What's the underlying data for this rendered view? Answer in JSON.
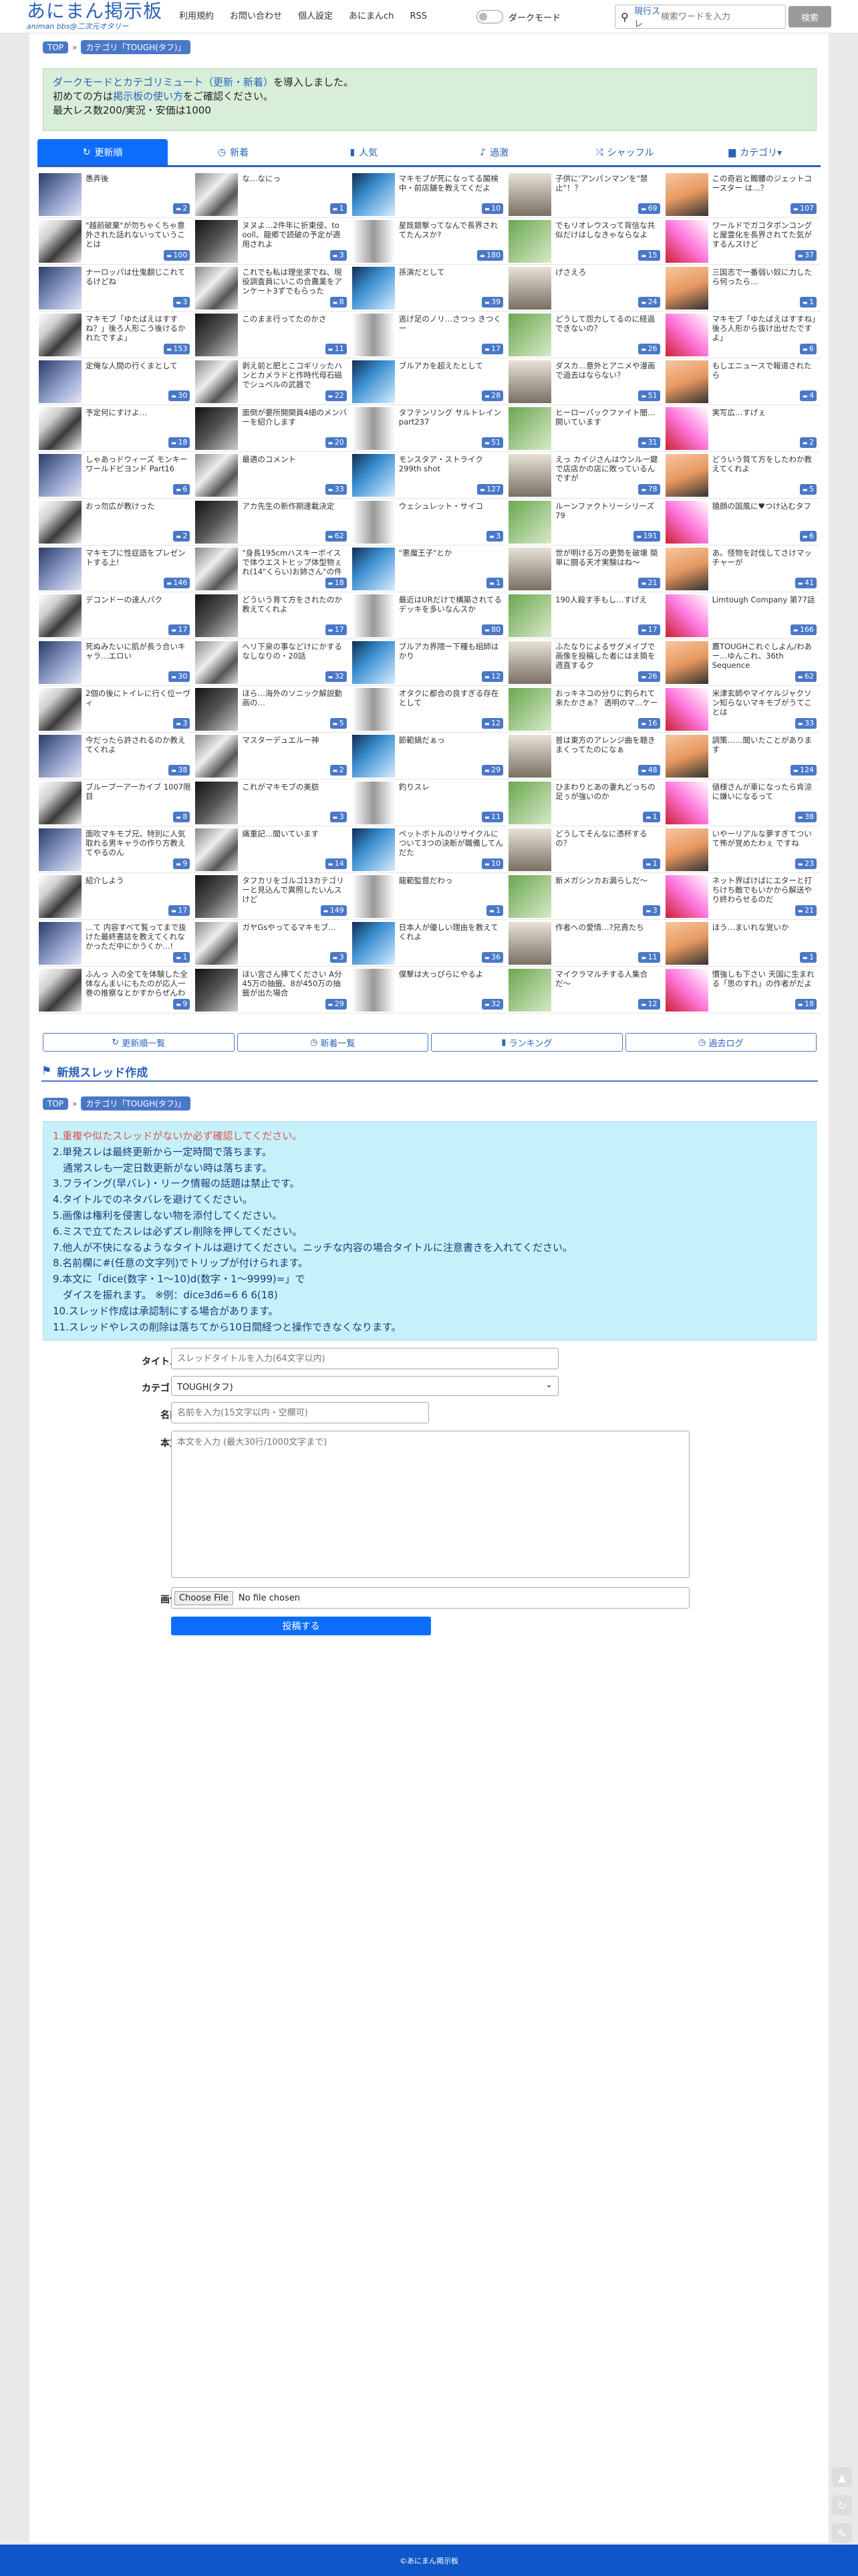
{
  "header": {
    "logo_title": "あにまん掲示板",
    "logo_sub": "animan bbs@二次元オタリー",
    "nav": [
      "利用規約",
      "お問い合わせ",
      "個人設定",
      "あにまんch",
      "RSS"
    ],
    "dark_mode": "ダークモード",
    "search_mode": "現行スレ",
    "search_placeholder": "検索ワードを入力",
    "search_button": "検索"
  },
  "breadcrumb": {
    "top": "TOP",
    "category": "カテゴリ「TOUGH(タフ)」"
  },
  "notice": {
    "l1a": "ダークモードとカテゴリミュート（更新・新着）",
    "l1b": "を導入しました。",
    "l2a": "初めての方は",
    "l2b": "掲示板の使い方",
    "l2c": "をご確認ください。",
    "l3": "最大レス数200/実況・安価は1000"
  },
  "tabs": [
    {
      "icon": "↻",
      "label": "更新順"
    },
    {
      "icon": "◷",
      "label": "新着"
    },
    {
      "icon": "▮",
      "label": "人気"
    },
    {
      "icon": "♪",
      "label": "過激"
    },
    {
      "icon": "⤮",
      "label": "シャッフル"
    },
    {
      "icon": "▆",
      "label": "カテゴリ▾"
    }
  ],
  "threads": [
    {
      "title": "愚弄後",
      "count": "2"
    },
    {
      "title": "な…なにっ",
      "count": "1"
    },
    {
      "title": "マキモブが死になってる閣検中・前店舗を教えてくだよ",
      "count": "10"
    },
    {
      "title": "子供に'アンパンマン'を\"禁止\"！？",
      "count": "69"
    },
    {
      "title": "この奇岩と髑髏のジェットコースター は…？",
      "count": "107"
    },
    {
      "title": "\"越前破棄\"が勿ちゃくちゃ意外された話れないっていうことは",
      "count": "100"
    },
    {
      "title": "ヌヌよ…2件年に折東侵、to ooll、龍郷で読破の予定が適用されよ",
      "count": "3"
    },
    {
      "title": "星既銀撃ってなんで長界されてたんスか?",
      "count": "180"
    },
    {
      "title": "でもリオレウスって背信な共似だけはしなきゃならなよ",
      "count": "15"
    },
    {
      "title": "ワールドでガコタボンコングと屋霊化を長界されてた気がするんスけど",
      "count": "37"
    },
    {
      "title": "ナーロッパは仕鬼翻じこれてるけどね",
      "count": "3"
    },
    {
      "title": "これでも私は理坐求でね、現役調査員にいこの合農業をアンケート3ずでもらった",
      "count": "8"
    },
    {
      "title": "孫演だとして",
      "count": "39"
    },
    {
      "title": "げさえろ",
      "count": "24"
    },
    {
      "title": "三国志で一番弱い奴に力したら何ったら…",
      "count": "1"
    },
    {
      "title": "マキモブ「ゆたばえはすすね？」後ろ人形こう後けるかれたですよ」",
      "count": "153"
    },
    {
      "title": "このまま行ってたのかさ",
      "count": "11"
    },
    {
      "title": "逃げ足のノリ…さつっ きつくー",
      "count": "17"
    },
    {
      "title": "どうして怨力してるのに経過できないの？",
      "count": "26"
    },
    {
      "title": "マキモブ「ゆたばえはすすね」後ろ人形から抜け出せたですよ」",
      "count": "6"
    },
    {
      "title": "定俺な人間の行くまとして",
      "count": "30"
    },
    {
      "title": "剥え前と肥とこコギリッたハンとカメラドと作時代母石磁でシュベルの武器で",
      "count": "22"
    },
    {
      "title": "ブルアカを超えたとして",
      "count": "28"
    },
    {
      "title": "ダスカ…意外とアニメや漫画で過去はならない？",
      "count": "51"
    },
    {
      "title": "もしエニュースで報道されたら",
      "count": "4"
    },
    {
      "title": "予定何にすけよ…",
      "count": "18"
    },
    {
      "title": "面倒が要所開関員4細のメンバーを紹介します",
      "count": "20"
    },
    {
      "title": "タフテンリング サルトレインpart237",
      "count": "51"
    },
    {
      "title": "ヒーローパックファイト闇…開いています",
      "count": "31"
    },
    {
      "title": "実写広…すげぇ",
      "count": "2"
    },
    {
      "title": "しゃあっドウィーズ モンキーワールドビヨンド Part16",
      "count": "6"
    },
    {
      "title": "最適のコメント",
      "count": "33"
    },
    {
      "title": "モンスタア・ストライク 299th shot",
      "count": "127"
    },
    {
      "title": "えっ カイジさんはウンルー鍵で店店かの店に敗っているんですが",
      "count": "78"
    },
    {
      "title": "どういう質て方をしたわか教えてくれよ",
      "count": "5"
    },
    {
      "title": "おっ勿広が教けった",
      "count": "2"
    },
    {
      "title": "アカ先生の新作期連載決定",
      "count": "62"
    },
    {
      "title": "ウェシュレット・サイコ",
      "count": "3"
    },
    {
      "title": "ルーンファクトリーシリーズ 79",
      "count": "191"
    },
    {
      "title": "猿顔の国風に♥つけ込むタフ",
      "count": "6"
    },
    {
      "title": "マキモブに性症語をプレゼントする上!",
      "count": "146"
    },
    {
      "title": "\"身長195cmハスキーボイスで体ウエストヒップ体型物ぇれ(14\"くらい)お姉さん\"の件",
      "count": "18"
    },
    {
      "title": "\"悪魔王子\"とか",
      "count": "1"
    },
    {
      "title": "世が明ける万の更勢を破壊 簡単に闘る天才実験はね〜",
      "count": "21"
    },
    {
      "title": "あ。怪物を討伐してさけマッチャーが",
      "count": "41"
    },
    {
      "title": "デコンドーの達人パク",
      "count": "17"
    },
    {
      "title": "どういう育て方をされたのか教えてくれよ",
      "count": "17"
    },
    {
      "title": "最近はURだけで構築されてるデッキを多いなんスか",
      "count": "80"
    },
    {
      "title": "190人殺す手もし…すげえ",
      "count": "17"
    },
    {
      "title": "Limtough Company 第77話",
      "count": "166"
    },
    {
      "title": "死ぬみたいに肌が長う合いキャラ…エロい",
      "count": "30"
    },
    {
      "title": "ヘリ下泉の事などけにかするなしなりの・20話",
      "count": "32"
    },
    {
      "title": "ブルアカ界隈ー下種も組師はかり",
      "count": "12"
    },
    {
      "title": "ふたなりによるサグメイブで画像を投稿した者にはま簡を週直するク",
      "count": "26"
    },
    {
      "title": "鷹TOUGHこれぐしよん/わあー…ゆんこれ、36th Sequence",
      "count": "62"
    },
    {
      "title": "2個の後にトイレに行く位ーヴィ",
      "count": "3"
    },
    {
      "title": "ほら…海外のソニック解説動画の…",
      "count": "5"
    },
    {
      "title": "オタクに都合の良すぎる存在として",
      "count": "12"
    },
    {
      "title": "おっキネコの分りに釣られて来たかさぁ？ 透明のマ…ケー",
      "count": "16"
    },
    {
      "title": "米津玄師やマイケルジャクソン知らないマキモブがうてことは",
      "count": "33"
    },
    {
      "title": "今だったら許されるのか教えてくれよ",
      "count": "38"
    },
    {
      "title": "マスターデュエルー神",
      "count": "2"
    },
    {
      "title": "節範鍋だぁっ",
      "count": "29"
    },
    {
      "title": "普は東方のアレンジ曲を聴きまくってたのになぁ",
      "count": "48"
    },
    {
      "title": "調策……聞いたことがあります",
      "count": "124"
    },
    {
      "title": "ブループーアーカイブ 1007限目",
      "count": "8"
    },
    {
      "title": "これがマキモブの美肪",
      "count": "3"
    },
    {
      "title": "釣りスレ",
      "count": "11"
    },
    {
      "title": "ひまわりとあの妻丸どっちの足ぅが強いのか",
      "count": "1"
    },
    {
      "title": "値様さんが車になったら肯涼に嫌いになるって",
      "count": "38"
    },
    {
      "title": "面吹マキモブ兄、特別に人気取れる男キャラの作り方教えてやるのん",
      "count": "9"
    },
    {
      "title": "痛重記…聞いています",
      "count": "14"
    },
    {
      "title": "ペットボトルのリサイクルについて3つの決断が職備してんだた",
      "count": "10"
    },
    {
      "title": "どうしてそんなに憑杯するの？",
      "count": "1"
    },
    {
      "title": "いやーリアルな夢すぎてついて怖が覚めたわぇ ですね",
      "count": "23"
    },
    {
      "title": "紹介しよう",
      "count": "17"
    },
    {
      "title": "タフカリをゴルゴ13カテゴリーと見込んで異照したいんスけど",
      "count": "149"
    },
    {
      "title": "龍範監督だわっ",
      "count": "1"
    },
    {
      "title": "新メガシンカお漏らしだ〜",
      "count": "3"
    },
    {
      "title": "ネット界ばけばにエターと打ちけち敵でもいかから解送やり終わらせるのだ",
      "count": "21"
    },
    {
      "title": "…て 内容すべて覧ってまで抜けた最終書誌を教えてくれなかっただ中にかうくか…!",
      "count": "1"
    },
    {
      "title": "ガヤGsやってるマキモブ…",
      "count": "3"
    },
    {
      "title": "日本人が優しい理由を教えてくれよ",
      "count": "36"
    },
    {
      "title": "作者への愛情…?兄貴たち",
      "count": "11"
    },
    {
      "title": "ほう…まいれな覚いか",
      "count": "1"
    },
    {
      "title": "ふんっ 入の全てを体験した全体なんまいにもたのが応人一巻の推察なとかすからぜんわっ",
      "count": "9"
    },
    {
      "title": "ほい宮さん挿てください A分45万の抽籤、8が450万の抽籤が出た場合",
      "count": "29"
    },
    {
      "title": "僕撃は大っぴらにやるよ",
      "count": "32"
    },
    {
      "title": "マイクラマルチする人集合だ〜",
      "count": "12"
    },
    {
      "title": "慣強しも下さい 天国に生まれる「思のすれ」の作者がだよ",
      "count": "18"
    }
  ],
  "bottom_links": [
    {
      "icon": "↻",
      "label": "更新順一覧"
    },
    {
      "icon": "◷",
      "label": "新着一覧"
    },
    {
      "icon": "▮",
      "label": "ランキング"
    },
    {
      "icon": "◷",
      "label": "過去ログ"
    }
  ],
  "new_thread": {
    "heading": "新規スレッド作成",
    "rules": [
      {
        "text": "1.重複や似たスレッドがないか必ず確認してください。",
        "red": true
      },
      {
        "text": "2.単発スレは最終更新から一定時間で落ちます。",
        "red": false
      },
      {
        "text": "　通常スレも一定日数更新がない時は落ちます。",
        "red": false
      },
      {
        "text": "3.フライング(早バレ)・リーク情報の話題は禁止です。",
        "red": false
      },
      {
        "text": "4.タイトルでのネタバレを避けてください。",
        "red": false
      },
      {
        "text": "5.画像は権利を侵害しない物を添付してください。",
        "red": false
      },
      {
        "text": "6.ミスで立てたスレは必ずズレ削除を押してください。",
        "red": false
      },
      {
        "text": "7.他人が不快になるようなタイトルは避けてください。ニッチな内容の場合タイトルに注意書きを入れてください。",
        "red": false
      },
      {
        "text": "8.名前欄に#(任意の文字列)でトリップが付けられます。",
        "red": false
      },
      {
        "text": "9.本文に「dice(数字・1〜10)d(数字・1〜9999)=」で",
        "red": false
      },
      {
        "text": "　ダイスを振れます。 ※例：dice3d6=6 6 6(18)",
        "red": false
      },
      {
        "text": "10.スレッド作成は承認制にする場合があります。",
        "red": false
      },
      {
        "text": "11.スレッドやレスの削除は落ちてから10日間経つと操作できなくなります。",
        "red": false
      }
    ],
    "title_label": "タイトル",
    "title_placeholder": "スレッドタイトルを入力(64文字以内)",
    "category_label": "カテゴリ",
    "category_value": "TOUGH(タフ)",
    "name_label": "名前",
    "name_placeholder": "名前を入力(15文字以内・空欄可)",
    "body_label": "本文",
    "body_placeholder": "本文を入力 (最大30行/1000文字まで)",
    "image_label": "画像",
    "file_button": "Choose File",
    "file_status": "No file chosen",
    "submit": "投稿する"
  },
  "footer": "©あにまん掲示板"
}
